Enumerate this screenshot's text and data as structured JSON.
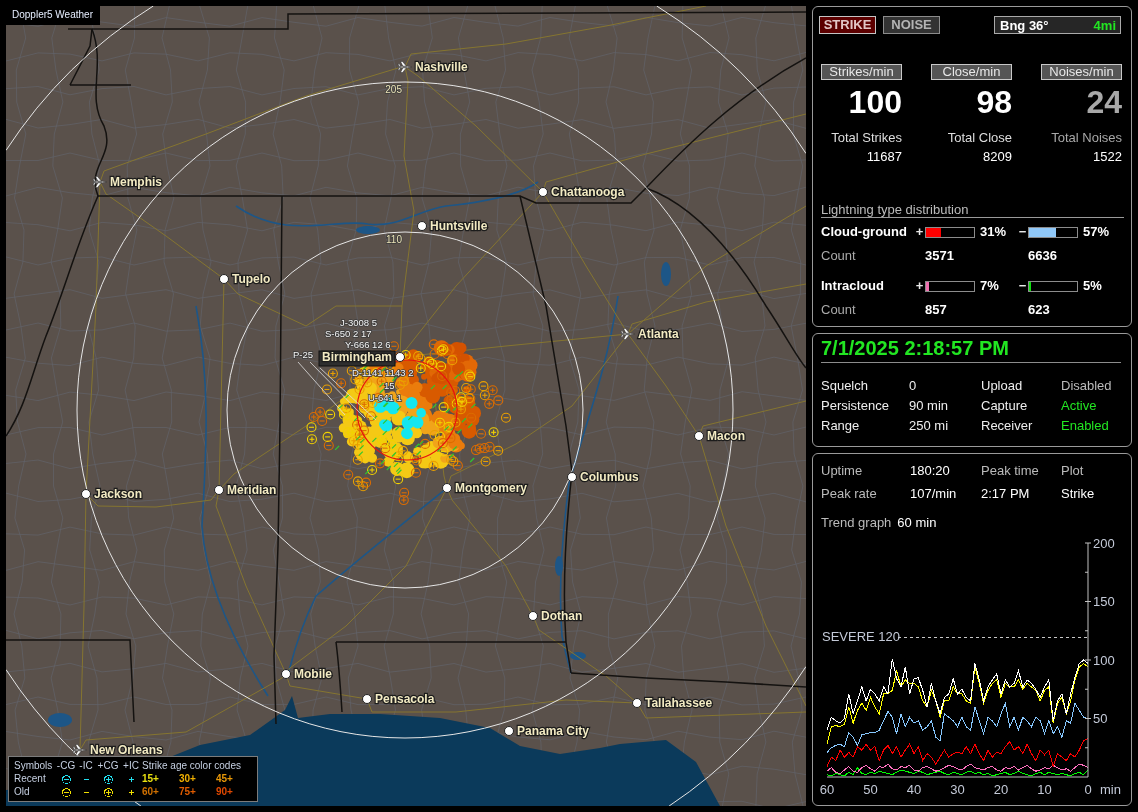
{
  "window": {
    "title": "Doppler5 Weather"
  },
  "map": {
    "range_rings": [
      {
        "label": "205"
      },
      {
        "label": "110"
      }
    ],
    "cities": [
      {
        "name": "Nashville",
        "kind": "airport",
        "highlighted": false
      },
      {
        "name": "Memphis",
        "kind": "airport",
        "highlighted": false
      },
      {
        "name": "Chattanooga",
        "kind": "town",
        "highlighted": false
      },
      {
        "name": "Huntsville",
        "kind": "town",
        "highlighted": false
      },
      {
        "name": "Tupelo",
        "kind": "town",
        "highlighted": false
      },
      {
        "name": "Atlanta",
        "kind": "airport",
        "highlighted": false
      },
      {
        "name": "Birmingham",
        "kind": "town",
        "highlighted": true
      },
      {
        "name": "Macon",
        "kind": "town",
        "highlighted": false
      },
      {
        "name": "Jackson",
        "kind": "town",
        "highlighted": false
      },
      {
        "name": "Meridian",
        "kind": "town",
        "highlighted": false
      },
      {
        "name": "Montgomery",
        "kind": "town",
        "highlighted": false
      },
      {
        "name": "Columbus",
        "kind": "town",
        "highlighted": false
      },
      {
        "name": "Dothan",
        "kind": "town",
        "highlighted": false
      },
      {
        "name": "Mobile",
        "kind": "town",
        "highlighted": false
      },
      {
        "name": "Pensacola",
        "kind": "town",
        "highlighted": false
      },
      {
        "name": "Tallahassee",
        "kind": "town",
        "highlighted": false
      },
      {
        "name": "Panama City",
        "kind": "town",
        "highlighted": false
      },
      {
        "name": "New Orleans",
        "kind": "airport",
        "highlighted": false
      }
    ],
    "strike_labels": [
      "J-3008 5",
      "S-650 2 17",
      "Y-666 12 6",
      "P-25",
      "D-1141 1143 2",
      "15",
      "U-641 1"
    ],
    "legend": {
      "symbols_label": "Symbols",
      "symbols": [
        {
          "label": "-CG",
          "kind": "circle-minus"
        },
        {
          "label": "-IC",
          "kind": "minus"
        },
        {
          "label": "+CG",
          "kind": "circle-plus"
        },
        {
          "label": "+IC",
          "kind": "plus"
        }
      ],
      "ages_label": "Strike age color codes",
      "rows": [
        {
          "label": "Recent",
          "color": "#22e0f0",
          "ages": [
            {
              "text": "15+",
              "color": "#e8e010"
            },
            {
              "text": "30+",
              "color": "#f0b000"
            },
            {
              "text": "45+",
              "color": "#e89808"
            }
          ]
        },
        {
          "label": "Old",
          "color": "#f0e000",
          "ages": [
            {
              "text": "60+",
              "color": "#d07000"
            },
            {
              "text": "75+",
              "color": "#e05c00"
            },
            {
              "text": "90+",
              "color": "#e04800"
            }
          ]
        }
      ]
    }
  },
  "mode_buttons": [
    {
      "label": "STRIKE",
      "selected": true
    },
    {
      "label": "NOISE",
      "selected": false
    }
  ],
  "bearing": {
    "label": "Bng 36°",
    "distance": "4mi"
  },
  "rates": [
    {
      "header": "Strikes/min",
      "value": "100",
      "total_label": "Total Strikes",
      "total": "11687",
      "dimmed": false
    },
    {
      "header": "Close/min",
      "value": "98",
      "total_label": "Total Close",
      "total": "8209",
      "dimmed": false
    },
    {
      "header": "Noises/min",
      "value": "24",
      "total_label": "Total Noises",
      "total": "1522",
      "dimmed": true
    }
  ],
  "distribution": {
    "title": "Lightning type distribution",
    "rows": [
      {
        "label": "Cloud-ground",
        "count_label": "Count",
        "bars": [
          {
            "sign": "+",
            "color": "#ff0000",
            "level": 0.31,
            "percent": "31%",
            "count": "3571"
          },
          {
            "sign": "−",
            "color": "#90c8f8",
            "level": 0.57,
            "percent": "57%",
            "count": "6636"
          }
        ]
      },
      {
        "label": "Intracloud",
        "count_label": "Count",
        "bars": [
          {
            "sign": "+",
            "color": "#f070b0",
            "level": 0.07,
            "percent": "7%",
            "count": "857"
          },
          {
            "sign": "−",
            "color": "#10e010",
            "level": 0.05,
            "percent": "5%",
            "count": "623"
          }
        ]
      }
    ]
  },
  "status": {
    "datetime": "7/1/2025 2:18:57 PM",
    "rows": [
      {
        "label": "Squelch",
        "value": "0",
        "state_label": "Upload",
        "state": "Disabled",
        "on": false
      },
      {
        "label": "Persistence",
        "value": "90 min",
        "state_label": "Capture",
        "state": "Active",
        "on": true
      },
      {
        "label": "Range",
        "value": "250 mi",
        "state_label": "Receiver",
        "state": "Enabled",
        "on": true
      }
    ]
  },
  "activity": {
    "rows": [
      [
        {
          "text": "Uptime",
          "kind": "label"
        },
        {
          "text": "180:20",
          "kind": "value"
        },
        {
          "text": "Peak time",
          "kind": "label"
        },
        {
          "text": "Plot",
          "kind": "label"
        }
      ],
      [
        {
          "text": "Peak rate",
          "kind": "label"
        },
        {
          "text": "107/min",
          "kind": "value"
        },
        {
          "text": "2:17 PM",
          "kind": "value"
        },
        {
          "text": "Strike",
          "kind": "value"
        }
      ]
    ],
    "trend": {
      "label": "Trend graph",
      "value": "60 min"
    },
    "chart_data": {
      "type": "line",
      "xlabel": "min",
      "x": [
        60,
        59,
        58,
        57,
        56,
        55,
        54,
        53,
        52,
        51,
        50,
        49,
        48,
        47,
        46,
        45,
        44,
        43,
        42,
        41,
        40,
        39,
        38,
        37,
        36,
        35,
        34,
        33,
        32,
        31,
        30,
        29,
        28,
        27,
        26,
        25,
        24,
        23,
        22,
        21,
        20,
        19,
        18,
        17,
        16,
        15,
        14,
        13,
        12,
        11,
        10,
        9,
        8,
        7,
        6,
        5,
        4,
        3,
        2,
        1,
        0
      ],
      "xlim": [
        60,
        0
      ],
      "ylim": [
        0,
        200
      ],
      "xticks": [
        60,
        50,
        40,
        30,
        20,
        10,
        0
      ],
      "yticks": [
        50,
        100,
        150,
        200
      ],
      "series": [
        {
          "color": "#ffffff",
          "values": [
            40,
            51,
            48,
            46,
            50,
            71,
            54,
            65,
            77,
            65,
            75,
            71,
            65,
            77,
            71,
            101,
            84,
            77,
            94,
            71,
            84,
            85,
            74,
            60,
            80,
            65,
            54,
            68,
            71,
            84,
            71,
            75,
            68,
            65,
            97,
            83,
            65,
            77,
            83,
            88,
            71,
            83,
            77,
            80,
            91,
            77,
            83,
            80,
            75,
            68,
            77,
            83,
            48,
            65,
            71,
            54,
            71,
            85,
            97,
            100,
            97
          ]
        },
        {
          "color": "#ffff00",
          "values": [
            28,
            43,
            44,
            43,
            45,
            60,
            46,
            57,
            63,
            57,
            68,
            60,
            54,
            71,
            71,
            74,
            91,
            77,
            83,
            80,
            80,
            77,
            65,
            60,
            74,
            65,
            51,
            65,
            65,
            77,
            71,
            71,
            65,
            63,
            94,
            80,
            63,
            74,
            80,
            83,
            68,
            80,
            77,
            77,
            83,
            75,
            80,
            77,
            74,
            65,
            74,
            77,
            46,
            63,
            68,
            54,
            65,
            83,
            94,
            97,
            94
          ]
        },
        {
          "color": "#88c8ff",
          "values": [
            21,
            25,
            27,
            28,
            26,
            38,
            34,
            27,
            36,
            37,
            38,
            38,
            40,
            48,
            56,
            51,
            37,
            54,
            43,
            51,
            46,
            48,
            40,
            43,
            48,
            34,
            31,
            54,
            51,
            48,
            43,
            51,
            43,
            40,
            60,
            48,
            37,
            51,
            48,
            43,
            54,
            63,
            43,
            51,
            40,
            51,
            48,
            43,
            51,
            48,
            37,
            48,
            37,
            43,
            34,
            48,
            46,
            63,
            57,
            51,
            50
          ]
        },
        {
          "color": "#ff0000",
          "values": [
            9,
            17,
            14,
            23,
            17,
            21,
            17,
            26,
            23,
            28,
            23,
            26,
            14,
            23,
            27,
            20,
            26,
            17,
            23,
            28,
            20,
            26,
            14,
            20,
            17,
            11,
            17,
            23,
            17,
            20,
            21,
            20,
            26,
            20,
            28,
            20,
            14,
            23,
            17,
            21,
            20,
            26,
            30,
            23,
            26,
            20,
            28,
            20,
            14,
            23,
            19,
            23,
            9,
            20,
            17,
            14,
            20,
            17,
            23,
            31,
            33
          ]
        },
        {
          "color": "#ff70c0",
          "values": [
            5,
            8,
            4,
            3,
            6,
            9,
            5,
            4,
            8,
            10,
            7,
            5,
            9,
            8,
            11,
            7,
            6,
            9,
            8,
            10,
            6,
            5,
            8,
            9,
            7,
            5,
            6,
            8,
            10,
            9,
            7,
            6,
            9,
            11,
            8,
            7,
            6,
            8,
            9,
            6,
            5,
            8,
            7,
            9,
            6,
            8,
            10,
            7,
            5,
            6,
            8,
            7,
            10,
            8,
            6,
            7,
            5,
            8,
            11,
            10,
            8
          ]
        },
        {
          "color": "#00ff00",
          "values": [
            2,
            1,
            3,
            2,
            1,
            4,
            2,
            8,
            3,
            2,
            4,
            3,
            5,
            4,
            3,
            2,
            4,
            6,
            5,
            4,
            3,
            5,
            4,
            2,
            3,
            4,
            5,
            3,
            2,
            4,
            3,
            2,
            4,
            5,
            3,
            4,
            2,
            3,
            1,
            2,
            3,
            4,
            2,
            3,
            5,
            3,
            2,
            1,
            3,
            4,
            2,
            4,
            3,
            2,
            3,
            2,
            1,
            3,
            4,
            2,
            6
          ]
        }
      ],
      "ref_lines": [
        {
          "axis": "y",
          "value": 120,
          "label": "SEVERE 120"
        }
      ]
    }
  }
}
